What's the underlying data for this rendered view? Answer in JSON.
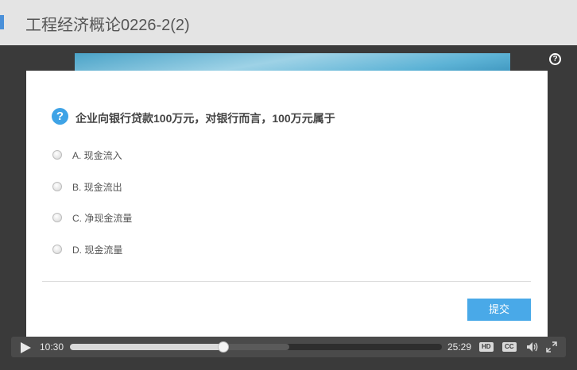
{
  "header": {
    "title": "工程经济概论0226-2(2)"
  },
  "quiz": {
    "question": "企业向银行贷款100万元，对银行而言，100万元属于",
    "options": [
      {
        "label": "A. 现金流入"
      },
      {
        "label": "B. 现金流出"
      },
      {
        "label": "C. 净现金流量"
      },
      {
        "label": "D. 现金流量"
      }
    ],
    "submit_label": "提交"
  },
  "player": {
    "current_time": "10:30",
    "total_time": "25:29",
    "progress_fraction": 0.413,
    "buffered_fraction": 0.59,
    "hd_label": "HD",
    "cc_label": "CC"
  },
  "icons": {
    "help": "help-icon",
    "question": "question-icon",
    "play": "play-icon",
    "volume": "volume-icon",
    "fullscreen": "fullscreen-icon"
  },
  "colors": {
    "accent": "#4a90d9",
    "button": "#49a9e8",
    "question_icon": "#3ea3e6"
  }
}
